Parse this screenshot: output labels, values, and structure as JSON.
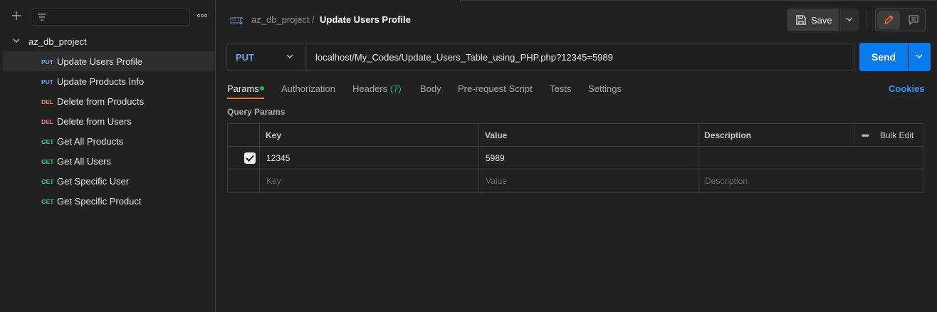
{
  "sidebar": {
    "collection_name": "az_db_project",
    "requests": [
      {
        "method": "PUT",
        "name": "Update Users Profile"
      },
      {
        "method": "PUT",
        "name": "Update Products Info"
      },
      {
        "method": "DEL",
        "name": "Delete from Products"
      },
      {
        "method": "DEL",
        "name": "Delete from Users"
      },
      {
        "method": "GET",
        "name": "Get All Products"
      },
      {
        "method": "GET",
        "name": "Get All Users"
      },
      {
        "method": "GET",
        "name": "Get Specific User"
      },
      {
        "method": "GET",
        "name": "Get Specific Product"
      }
    ]
  },
  "header": {
    "icon_text": "HTTP",
    "project": "az_db_project",
    "separator": "/",
    "title": "Update Users Profile",
    "save_label": "Save"
  },
  "request": {
    "method": "PUT",
    "url": "localhost/My_Codes/Update_Users_Table_using_PHP.php?12345=5989",
    "send_label": "Send"
  },
  "tabs": [
    {
      "label": "Params"
    },
    {
      "label": "Authorization"
    },
    {
      "label": "Headers",
      "count": "(7)"
    },
    {
      "label": "Body"
    },
    {
      "label": "Pre-request Script"
    },
    {
      "label": "Tests"
    },
    {
      "label": "Settings"
    }
  ],
  "cookies_label": "Cookies",
  "query_params": {
    "title": "Query Params",
    "columns": [
      "Key",
      "Value",
      "Description"
    ],
    "bulk_edit": "Bulk Edit",
    "more": "•••",
    "rows": [
      {
        "key": "12345",
        "value": "5989",
        "description": "",
        "checked": true
      }
    ],
    "placeholders": {
      "key": "Key",
      "value": "Value",
      "description": "Description"
    }
  },
  "colors": {
    "put": "#6ea4e8",
    "del": "#e8856e",
    "get": "#4ec27f",
    "send": "#097bed",
    "accent": "#ff6c37"
  }
}
